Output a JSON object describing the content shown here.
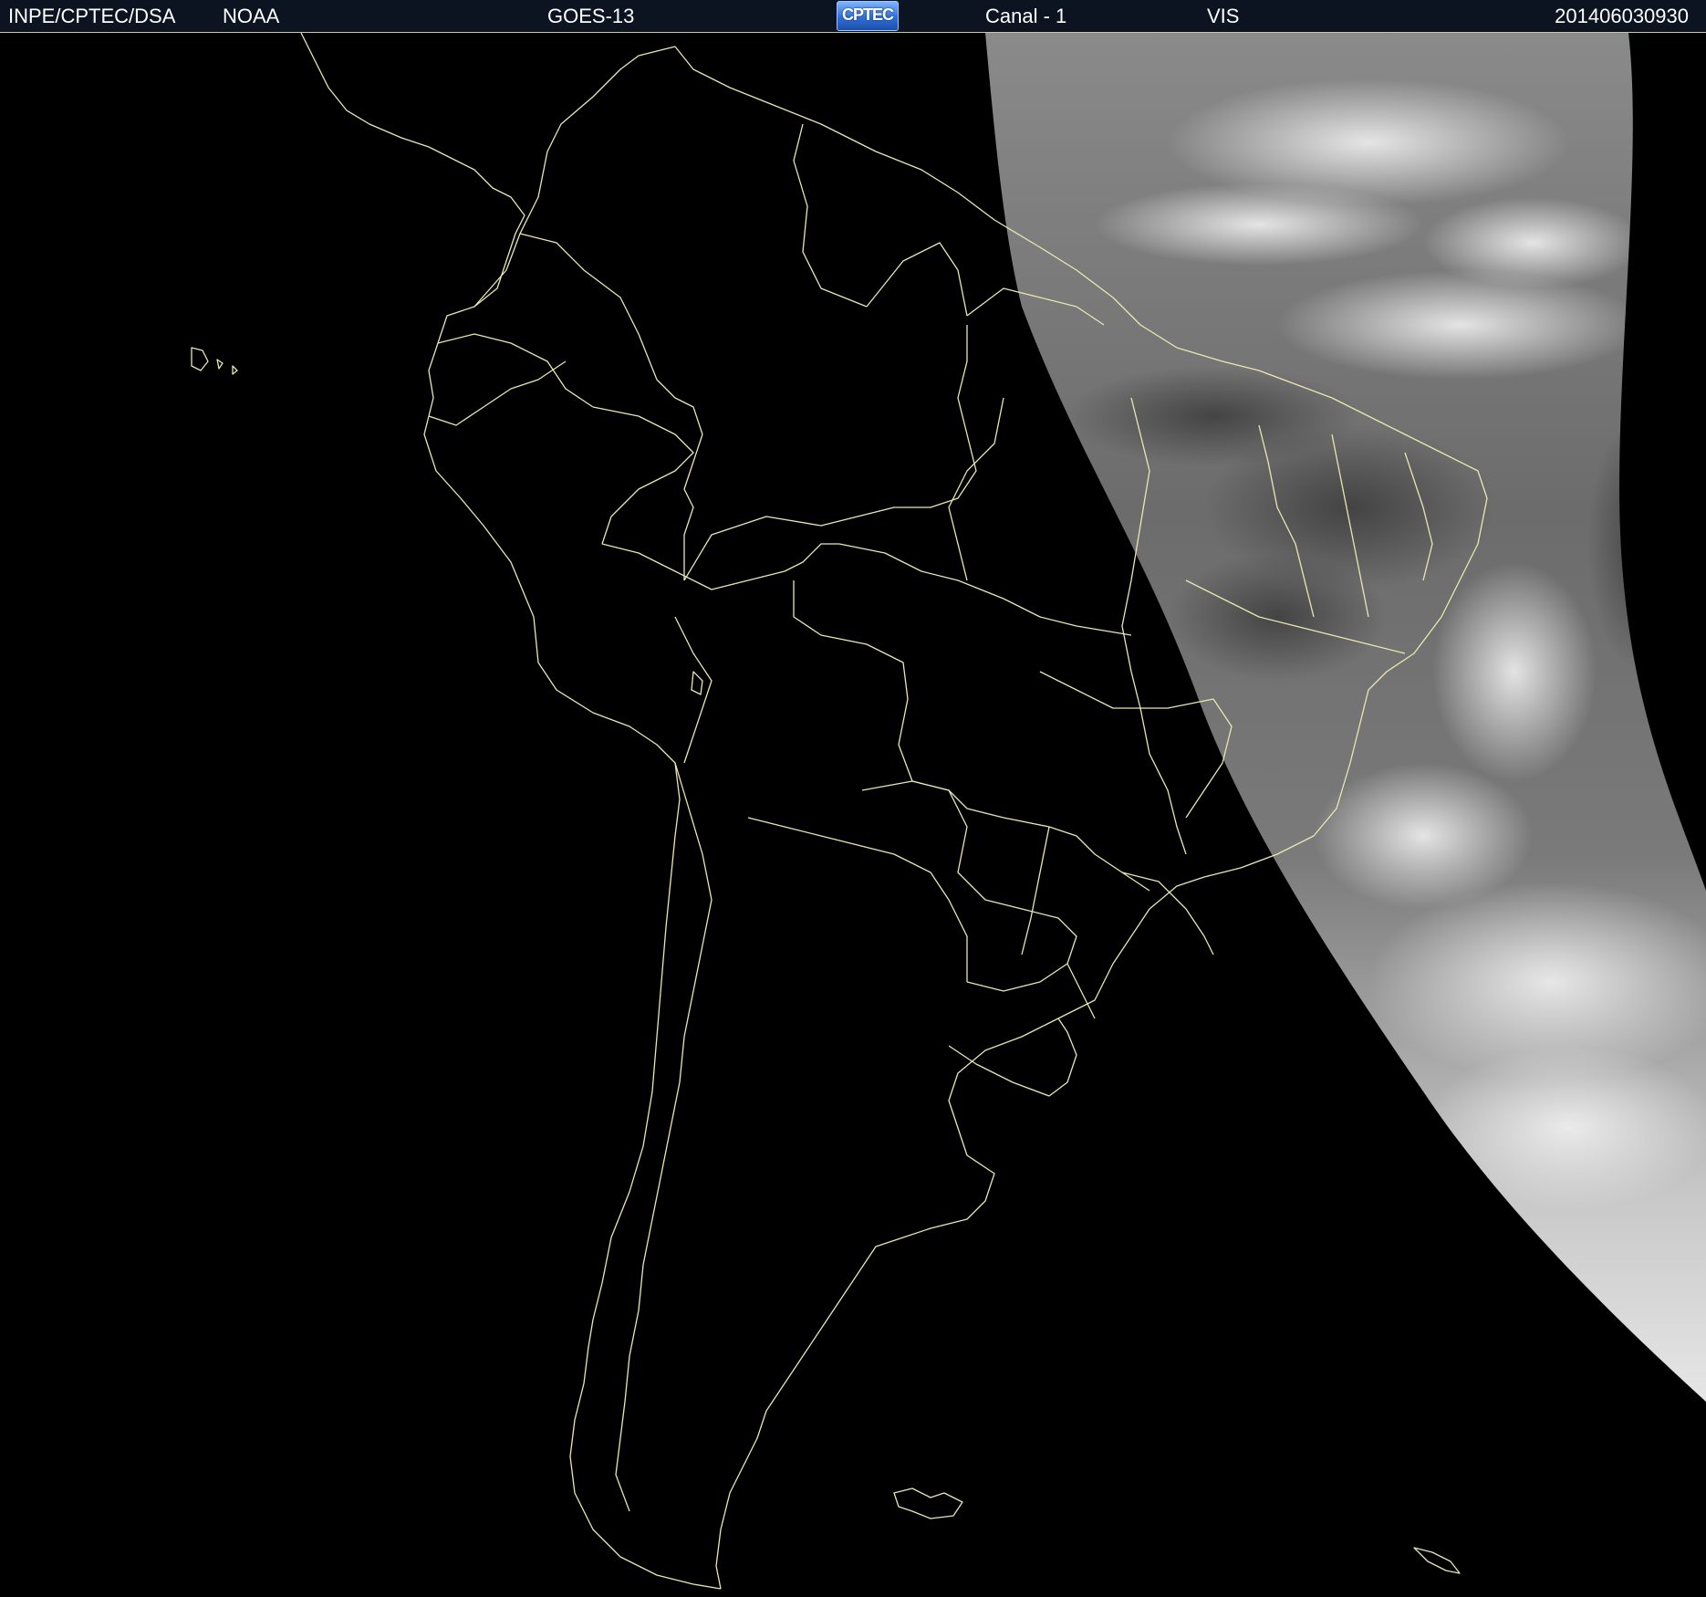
{
  "header": {
    "agency": "INPE/CPTEC/DSA",
    "source": "NOAA",
    "satellite": "GOES-13",
    "logo": "CPTEC",
    "channel": "Canal - 1",
    "band": "VIS",
    "timestamp": "201406030930"
  },
  "colors": {
    "header_background": "#0b1420",
    "boundary_lines": "#e8e8b0",
    "space_background": "#000000",
    "cloud_bright": "#e8e8e8",
    "cloud_dim": "#5a5a5a"
  }
}
